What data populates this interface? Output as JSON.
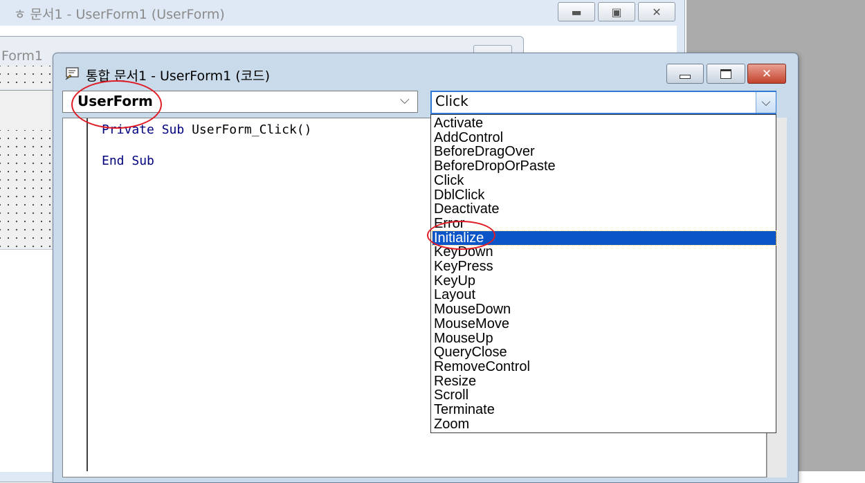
{
  "background_window": {
    "title": "문서1 - UserForm1 (UserForm)",
    "title_prefix": "ㅎ",
    "inner_form_title": "Form1"
  },
  "code_window": {
    "title": "통합 문서1 - UserForm1 (코드)",
    "controls": {
      "minimize": "minimize-icon",
      "maximize": "maximize-icon",
      "close": "close-icon"
    }
  },
  "object_combo": {
    "value": "UserForm"
  },
  "procedure_combo": {
    "value": "Click",
    "options": [
      "Activate",
      "AddControl",
      "BeforeDragOver",
      "BeforeDropOrPaste",
      "Click",
      "DblClick",
      "Deactivate",
      "Error",
      "Initialize",
      "KeyDown",
      "KeyPress",
      "KeyUp",
      "Layout",
      "MouseDown",
      "MouseMove",
      "MouseUp",
      "QueryClose",
      "RemoveControl",
      "Resize",
      "Scroll",
      "Terminate",
      "Zoom"
    ],
    "highlighted": "Initialize"
  },
  "code": {
    "line1_kw1": "Private",
    "line1_kw2": "Sub",
    "line1_rest": "UserForm_Click()",
    "line2_kw1": "End",
    "line2_kw2": "Sub"
  },
  "colors": {
    "selection": "#0a56c8",
    "annotation": "#e01b24",
    "keyword": "#00007f"
  }
}
